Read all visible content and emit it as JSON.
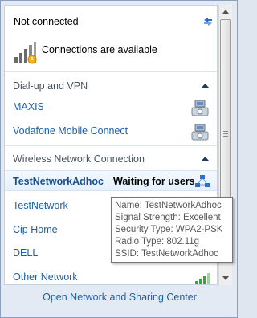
{
  "status": {
    "title": "Not connected",
    "message": "Connections are available",
    "refresh_icon": "refresh-icon",
    "status_icon": "signal-bars-warning-icon"
  },
  "dialup": {
    "header": "Dial-up and VPN",
    "items": [
      {
        "label": "MAXIS",
        "icon": "dialup-phone-icon"
      },
      {
        "label": "Vodafone Mobile Connect",
        "icon": "dialup-phone-icon"
      }
    ]
  },
  "wireless": {
    "header": "Wireless Network Connection",
    "items": [
      {
        "label": "TestNetworkAdhoc",
        "status": "Waiting for users",
        "selected": true,
        "icon": "adhoc-network-icon"
      },
      {
        "label": "TestNetwork"
      },
      {
        "label": "Cip Home"
      },
      {
        "label": "DELL"
      },
      {
        "label": "Other Network",
        "icon": "signal-strength-icon"
      }
    ]
  },
  "tooltip": {
    "name": "Name: TestNetworkAdhoc",
    "signal": "Signal Strength: Excellent",
    "security": "Security Type: WPA2-PSK",
    "radio": "Radio Type: 802.11g",
    "ssid": "SSID: TestNetworkAdhoc"
  },
  "footer": {
    "link": "Open Network and Sharing Center"
  },
  "colors": {
    "link": "#1f5fa8",
    "accent": "#1e395b",
    "background": "#e3eaf3"
  }
}
